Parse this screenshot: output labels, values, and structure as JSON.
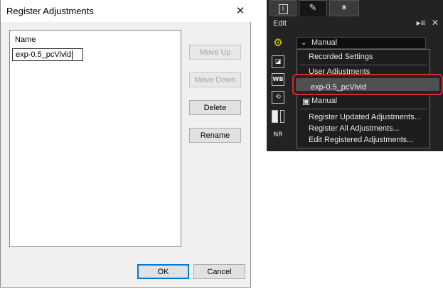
{
  "dialog": {
    "title": "Register Adjustments",
    "list_header": "Name",
    "edit_value": "exp-0.5_pcVivid",
    "buttons": {
      "move_up": "Move Up",
      "move_down": "Move Down",
      "delete": "Delete",
      "rename": "Rename",
      "ok": "OK",
      "cancel": "Cancel"
    }
  },
  "panel": {
    "tabs": [
      {
        "icon": "info-icon",
        "glyph": "i"
      },
      {
        "icon": "edit-pencil-icon",
        "glyph": "✎"
      },
      {
        "icon": "magic-wand-icon",
        "glyph": "✶"
      }
    ],
    "edit_label": "Edit",
    "controls": {
      "menu_icon": "▸≡",
      "close_icon": "✕"
    },
    "sidebar_icons": [
      "gear-icon",
      "exposure-icon",
      "white-balance-icon",
      "rotate-icon",
      "tone-icon",
      "noise-reduction-icon"
    ],
    "sidebar_glyphs": {
      "wb": "WB",
      "nr": "NR"
    },
    "dropdown_selected": "Manual",
    "menu_items": {
      "recorded_settings": "Recorded Settings",
      "user_adjustments_partial": "User Adjustments",
      "highlighted": "exp-0.5_pcVivid",
      "manual": "Manual",
      "register_updated": "Register Updated Adjustments...",
      "register_all": "Register All Adjustments...",
      "edit_registered": "Edit Registered Adjustments..."
    },
    "colors": {
      "highlight_border": "#d6282c"
    }
  }
}
